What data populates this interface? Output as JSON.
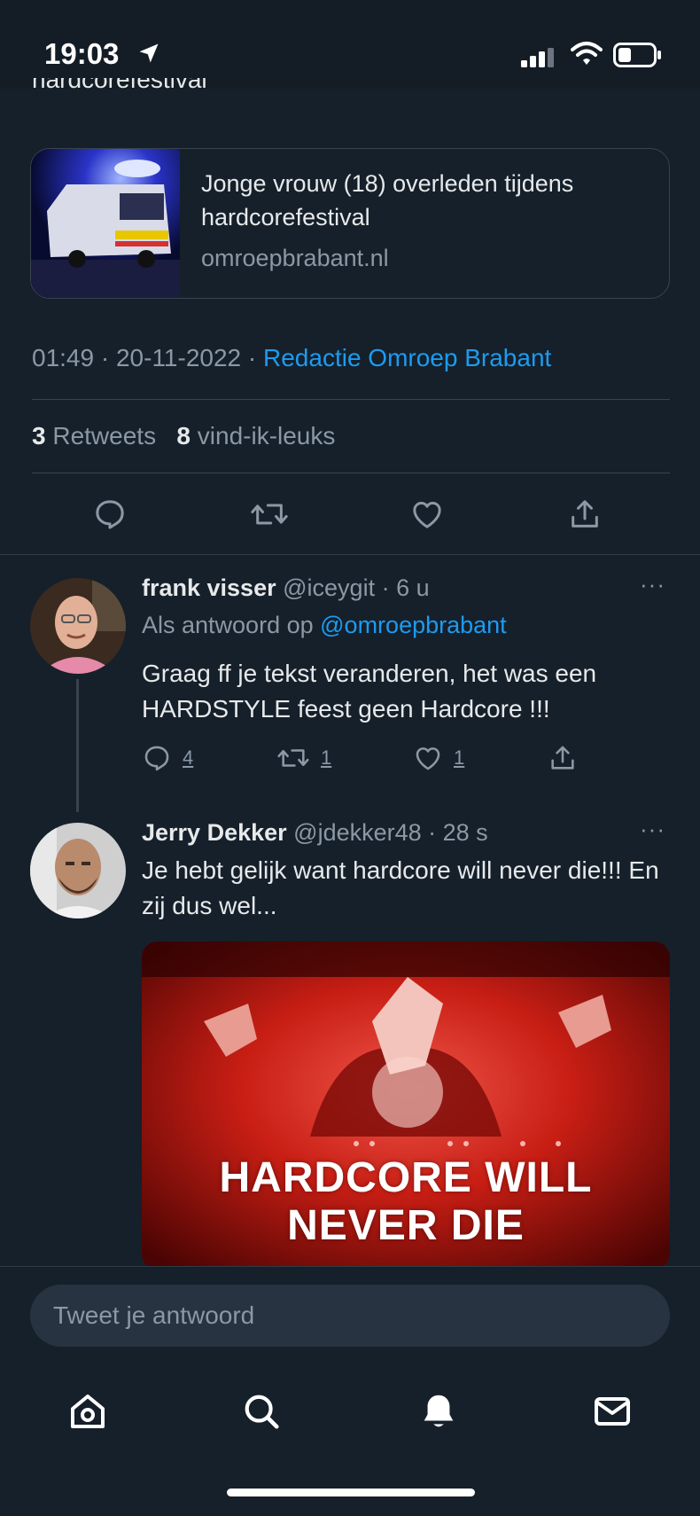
{
  "status_bar": {
    "time": "19:03"
  },
  "previous_text_fragment": "hardcorefestival",
  "link_card": {
    "title": "Jonge vrouw (18) overleden tijdens hardcorefestival",
    "domain": "omroepbrabant.nl"
  },
  "tweet_meta": {
    "time": "01:49",
    "separator": " · ",
    "date": "20-11-2022",
    "source": "Redactie Omroep Brabant"
  },
  "stats": {
    "retweets_count": "3",
    "retweets_label": "Retweets",
    "likes_count": "8",
    "likes_label": "vind-ik-leuks"
  },
  "replies": [
    {
      "display_name": "frank visser",
      "handle": "@iceygit",
      "age": "· 6 u",
      "reply_to_label": "Als antwoord op",
      "reply_to_handle": "@omroepbrabant",
      "text": "Graag ff je tekst veranderen, het was een HARDSTYLE feest geen Hardcore !!!",
      "reply_count": "4",
      "retweet_count": "1",
      "like_count": "1",
      "more": "···"
    },
    {
      "display_name": "Jerry Dekker",
      "handle": "@jdekker48",
      "age": "· 28 s",
      "text": "Je hebt gelijk want hardcore will never die!!! En zij dus wel...",
      "more": "···",
      "gif_caption_line1": "HARDCORE WILL",
      "gif_caption_line2": "NEVER DIE"
    }
  ],
  "composer": {
    "placeholder": "Tweet je antwoord"
  },
  "icons": {
    "status": [
      "location-arrow-icon",
      "signal-icon",
      "wifi-icon",
      "battery-icon"
    ],
    "actions": [
      "reply-icon",
      "retweet-icon",
      "like-icon",
      "share-icon"
    ],
    "nav": [
      "home-icon",
      "search-icon",
      "notifications-icon",
      "messages-icon"
    ]
  },
  "colors": {
    "background": "#15202b",
    "link": "#1d9bf0",
    "muted": "#8b98a5",
    "border": "#38444d"
  }
}
